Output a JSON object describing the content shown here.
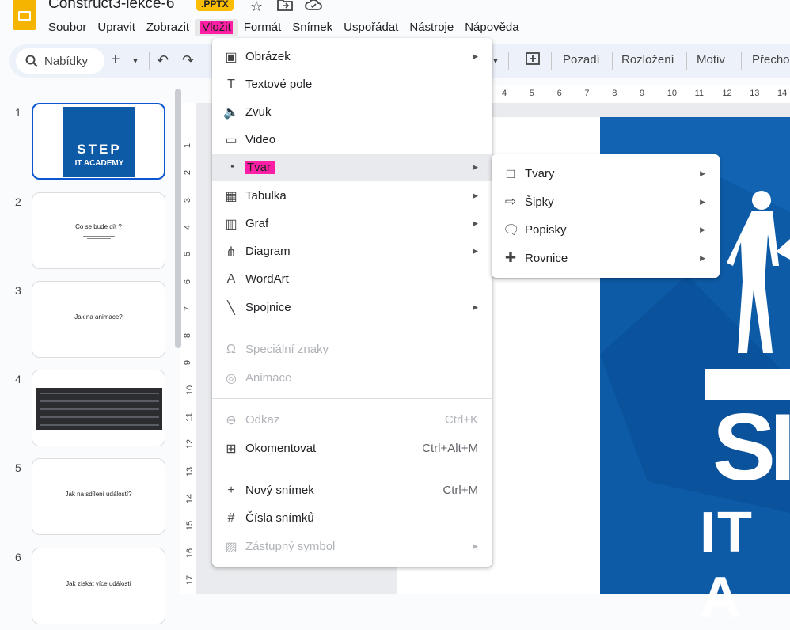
{
  "app": {
    "doc_title": "Construct3-lekce-6",
    "badge": ".PPTX"
  },
  "menubar": [
    {
      "label": "Soubor"
    },
    {
      "label": "Upravit"
    },
    {
      "label": "Zobrazit"
    },
    {
      "label": "Vložit",
      "active": true
    },
    {
      "label": "Formát"
    },
    {
      "label": "Snímek"
    },
    {
      "label": "Uspořádat"
    },
    {
      "label": "Nástroje"
    },
    {
      "label": "Nápověda"
    }
  ],
  "toolbar": {
    "search_label": "Nabídky",
    "background": "Pozadí",
    "layout": "Rozložení",
    "theme": "Motiv",
    "transition": "Přecho"
  },
  "slides": [
    {
      "num": "1",
      "caption": ""
    },
    {
      "num": "2",
      "caption": "Co se bude dít ?"
    },
    {
      "num": "3",
      "caption": "Jak na animace?"
    },
    {
      "num": "4",
      "caption": ""
    },
    {
      "num": "5",
      "caption": "Jak na sdílení událostí?"
    },
    {
      "num": "6",
      "caption": "Jak získat více událostí"
    }
  ],
  "logo_text": {
    "line1": "STEP",
    "line2": "IT ACADEMY"
  },
  "vruler": [
    "1",
    "2",
    "3",
    "4",
    "5",
    "6",
    "7",
    "8",
    "9",
    "10",
    "11",
    "12",
    "13",
    "14",
    "15",
    "16",
    "17"
  ],
  "hruler": [
    "4",
    "5",
    "6",
    "7",
    "8",
    "9",
    "10",
    "11",
    "12",
    "13",
    "14"
  ],
  "insert_menu": {
    "items": [
      {
        "label": "Obrázek",
        "icon": "image-icon",
        "glyph": "▣",
        "arrow": true
      },
      {
        "label": "Textové pole",
        "icon": "text-box-icon",
        "glyph": "T",
        "arrow": false
      },
      {
        "label": "Zvuk",
        "icon": "audio-icon",
        "glyph": "🔈",
        "arrow": false
      },
      {
        "label": "Video",
        "icon": "video-icon",
        "glyph": "▭",
        "arrow": false
      },
      {
        "label": "Tvar",
        "icon": "shape-icon",
        "glyph": "◔",
        "arrow": true,
        "highlighted": true
      },
      {
        "label": "Tabulka",
        "icon": "table-icon",
        "glyph": "▦",
        "arrow": true
      },
      {
        "label": "Graf",
        "icon": "chart-icon",
        "glyph": "▥",
        "arrow": true
      },
      {
        "label": "Diagram",
        "icon": "diagram-icon",
        "glyph": "⋔",
        "arrow": true
      },
      {
        "label": "WordArt",
        "icon": "wordart-icon",
        "glyph": "A",
        "arrow": false
      },
      {
        "label": "Spojnice",
        "icon": "line-icon",
        "glyph": "╲",
        "arrow": true
      },
      {
        "label": "Speciální znaky",
        "icon": "omega-icon",
        "glyph": "Ω",
        "disabled": true
      },
      {
        "label": "Animace",
        "icon": "animation-icon",
        "glyph": "◎",
        "disabled": true
      },
      {
        "label": "Odkaz",
        "icon": "link-icon",
        "glyph": "⊖",
        "shortcut": "Ctrl+K",
        "disabled": true
      },
      {
        "label": "Okomentovat",
        "icon": "comment-icon",
        "glyph": "⊞",
        "shortcut": "Ctrl+Alt+M"
      },
      {
        "label": "Nový snímek",
        "icon": "plus-icon",
        "glyph": "+",
        "shortcut": "Ctrl+M"
      },
      {
        "label": "Čísla snímků",
        "icon": "hash-icon",
        "glyph": "#"
      },
      {
        "label": "Zástupný symbol",
        "icon": "placeholder-icon",
        "glyph": "▨",
        "arrow": true,
        "disabled": true
      }
    ]
  },
  "shape_submenu": {
    "items": [
      {
        "label": "Tvary",
        "icon": "square-icon",
        "glyph": "□"
      },
      {
        "label": "Šipky",
        "icon": "arrow-icon",
        "glyph": "⇨"
      },
      {
        "label": "Popisky",
        "icon": "callout-icon",
        "glyph": "🗨"
      },
      {
        "label": "Rovnice",
        "icon": "equation-icon",
        "glyph": "✚"
      }
    ]
  }
}
